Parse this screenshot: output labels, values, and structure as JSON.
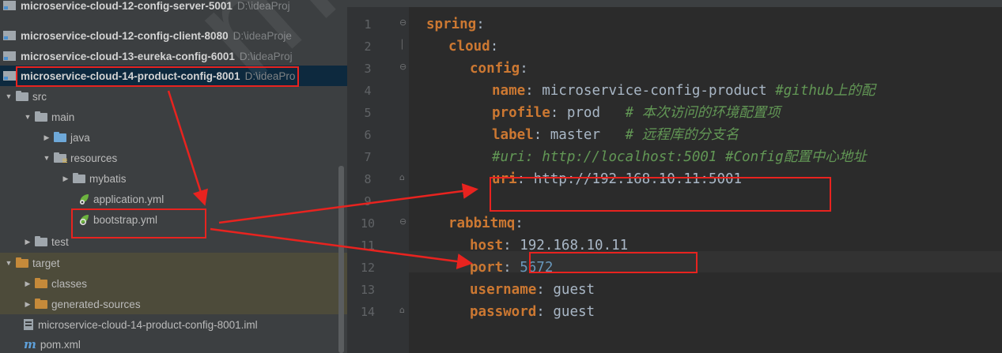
{
  "project_tree": {
    "rows": [
      {
        "name": "microservice-cloud-12-config-server-5001",
        "path": "D:\\ideaProj"
      },
      {
        "name": "microservice-cloud-12-config-client-8080",
        "path": "D:\\ideaProje"
      },
      {
        "name": "microservice-cloud-13-eureka-config-6001",
        "path": "D:\\ideaProj"
      },
      {
        "name": "microservice-cloud-14-product-config-8001",
        "path": "D:\\ideaPro"
      }
    ],
    "src": "src",
    "main": "main",
    "java": "java",
    "resources": "resources",
    "mybatis": "mybatis",
    "application_yml": "application.yml",
    "bootstrap_yml": "bootstrap.yml",
    "test": "test",
    "target": "target",
    "classes": "classes",
    "generated_sources": "generated-sources",
    "iml_file": "microservice-cloud-14-product-config-8001.iml",
    "pom": "pom.xml"
  },
  "editor": {
    "line_numbers": [
      "1",
      "2",
      "3",
      "4",
      "5",
      "6",
      "7",
      "8",
      "9",
      "10",
      "11",
      "12",
      "13",
      "14"
    ],
    "lines": {
      "l1_key": "spring",
      "l2_key": "cloud",
      "l3_key": "config",
      "l4_key": "name",
      "l4_val": " microservice-config-product ",
      "l4_comment": "#github上的配",
      "l5_key": "profile",
      "l5_val": " prod   ",
      "l5_comment": "# 本次访问的环境配置项",
      "l6_key": "label",
      "l6_val": " master   ",
      "l6_comment": "# 远程库的分支名",
      "l7_comment": "#uri: http://localhost:5001 #Config配置中心地址",
      "l8_key": "uri",
      "l8_val": " http://192.168.10.11:5001",
      "l10_key": "rabbitmq",
      "l11_key": "host",
      "l11_val": "192.168.10.11",
      "l12_key": "port",
      "l12_val": "5672",
      "l13_key": "username",
      "l13_val": " guest",
      "l14_key": "password",
      "l14_val": " guest"
    }
  },
  "colors": {
    "highlight": "#e8231f",
    "yaml_key": "#cc7832",
    "yaml_value": "#a9b7c6",
    "yaml_number": "#6897bb",
    "yaml_comment": "#629755"
  },
  "watermark": "menxu"
}
